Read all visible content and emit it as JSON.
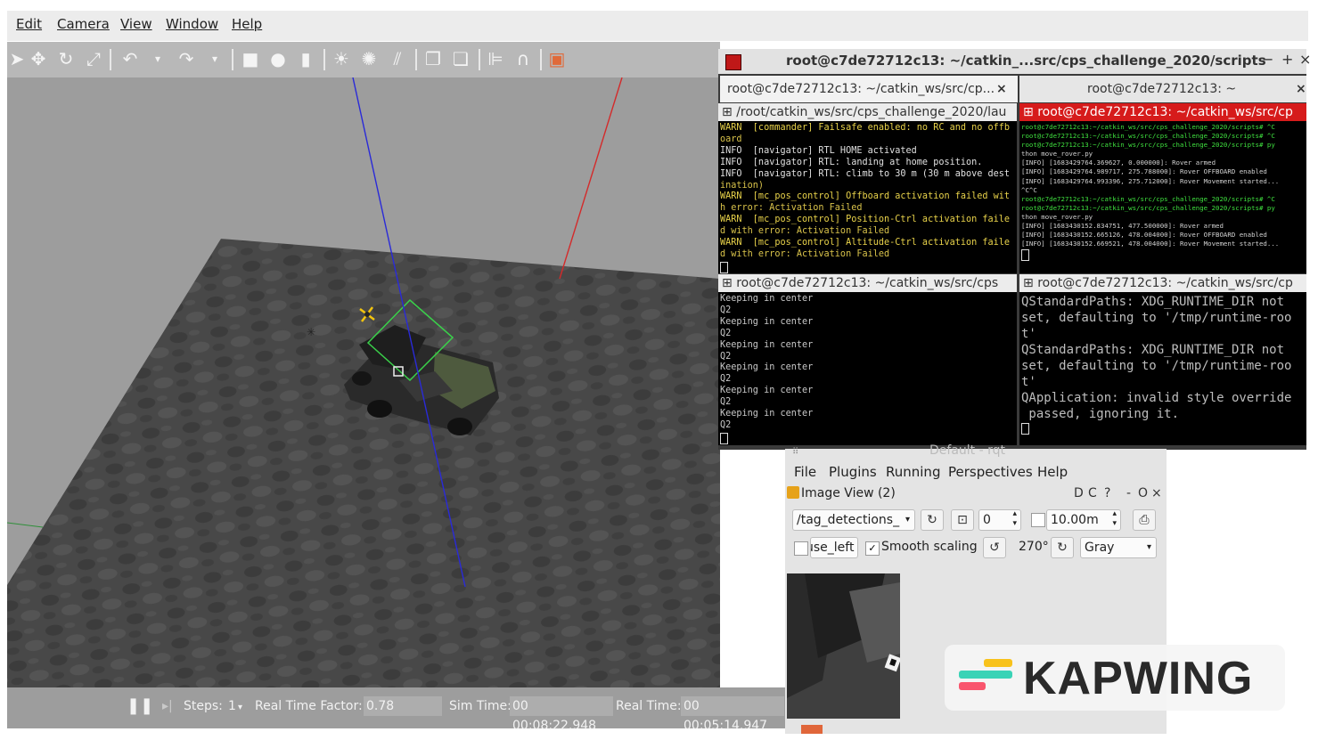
{
  "gazebo": {
    "menu": [
      "Edit",
      "Camera",
      "View",
      "Window",
      "Help"
    ],
    "toolbar_icons": [
      "select-arrow-icon",
      "translate-icon",
      "rotate-icon",
      "scale-icon",
      "undo-icon",
      "undo-dropdown-icon",
      "redo-icon",
      "redo-dropdown-icon",
      "box-icon",
      "sphere-icon",
      "cylinder-icon",
      "point-light-icon",
      "spot-light-icon",
      "directional-light-icon",
      "copy-icon",
      "paste-icon",
      "align-icon",
      "snap-icon",
      "screenshot-icon"
    ],
    "status": {
      "pause_icon": "pause-icon",
      "step_icon": "step-icon",
      "steps_label": "Steps:",
      "steps_value": "1",
      "rtf_label": "Real Time Factor:",
      "rtf_value": "0.78",
      "sim_time_label": "Sim Time:",
      "sim_time_value": "00 00:08:22.948",
      "real_time_label": "Real Time:",
      "real_time_value": "00 00:05:14.947"
    }
  },
  "terminal": {
    "title": "root@c7de72712c13: ~/catkin_...src/cps_challenge_2020/scripts",
    "controls": [
      "−",
      "+",
      "×"
    ],
    "tabs": [
      "root@c7de72712c13: ~/catkin_ws/src/cp...",
      "root@c7de72712c13: ~"
    ],
    "tab_close": "×",
    "panes": [
      {
        "header": "/root/catkin_ws/src/cps_challenge_2020/lau",
        "lines": [
          "WARN  [commander] Failsafe enabled: no RC and no offb",
          "oard",
          "INFO  [navigator] RTL HOME activated",
          "INFO  [navigator] RTL: landing at home position.",
          "INFO  [navigator] RTL: climb to 30 m (30 m above dest",
          "ination)",
          "WARN  [mc_pos_control] Offboard activation failed wit",
          "h error: Activation Failed",
          "WARN  [mc_pos_control] Position-Ctrl activation faile",
          "d with error: Activation Failed",
          "WARN  [mc_pos_control] Altitude-Ctrl activation faile",
          "d with error: Activation Failed"
        ]
      },
      {
        "header": "root@c7de72712c13: ~/catkin_ws/src/cp",
        "lines": [
          "root@c7de72712c13:~/catkin_ws/src/cps_challenge_2020/scripts# ^C",
          "root@c7de72712c13:~/catkin_ws/src/cps_challenge_2020/scripts# ^C",
          "root@c7de72712c13:~/catkin_ws/src/cps_challenge_2020/scripts# py",
          "thon move_rover.py",
          "[INFO] [1683429764.369627, 0.000000]: Rover armed",
          "[INFO] [1683429764.989717, 275.788000]: Rover OFFBOARD enabled",
          "[INFO] [1683429764.993396, 275.712000]: Rover Movement started...",
          "",
          "^C^C",
          "root@c7de72712c13:~/catkin_ws/src/cps_challenge_2020/scripts# ^C",
          "root@c7de72712c13:~/catkin_ws/src/cps_challenge_2020/scripts# py",
          "thon move_rover.py",
          "[INFO] [1683430152.834751, 477.500000]: Rover armed",
          "[INFO] [1683430152.665126, 478.004000]: Rover OFFBOARD enabled",
          "[INFO] [1683430152.669521, 478.004000]: Rover Movement started..."
        ]
      },
      {
        "header": "root@c7de72712c13: ~/catkin_ws/src/cps",
        "lines": [
          "Keeping in center",
          "Q2",
          "Keeping in center",
          "Q2",
          "Keeping in center",
          "Q2",
          "Keeping in center",
          "Q2",
          "Keeping in center",
          "Q2",
          "Keeping in center",
          "Q2"
        ]
      },
      {
        "header": "root@c7de72712c13: ~/catkin_ws/src/cp",
        "lines": [
          "QStandardPaths: XDG_RUNTIME_DIR not",
          "set, defaulting to '/tmp/runtime-roo",
          "t'",
          "QStandardPaths: XDG_RUNTIME_DIR not",
          "set, defaulting to '/tmp/runtime-roo",
          "t'",
          "QApplication: invalid style override",
          " passed, ignoring it."
        ]
      }
    ]
  },
  "rqt": {
    "window_title": "Default - rqt",
    "menu": [
      "File",
      "Plugins",
      "Running",
      "Perspectives",
      "Help"
    ],
    "plugin_title": "Image View (2)",
    "plugin_controls": [
      "D",
      "C",
      "?",
      "-",
      "O",
      "×"
    ],
    "topic": "/tag_detections_",
    "frame_value": "0",
    "duration_value": "10.00m",
    "use_left_label": "use_left",
    "smooth_label": "Smooth scaling",
    "rotation_value": "270°",
    "color_value": "Gray"
  },
  "watermark": {
    "text": "KAPWING",
    "colors": [
      "#f8c21c",
      "#3ad3b6",
      "#f9556d"
    ]
  }
}
